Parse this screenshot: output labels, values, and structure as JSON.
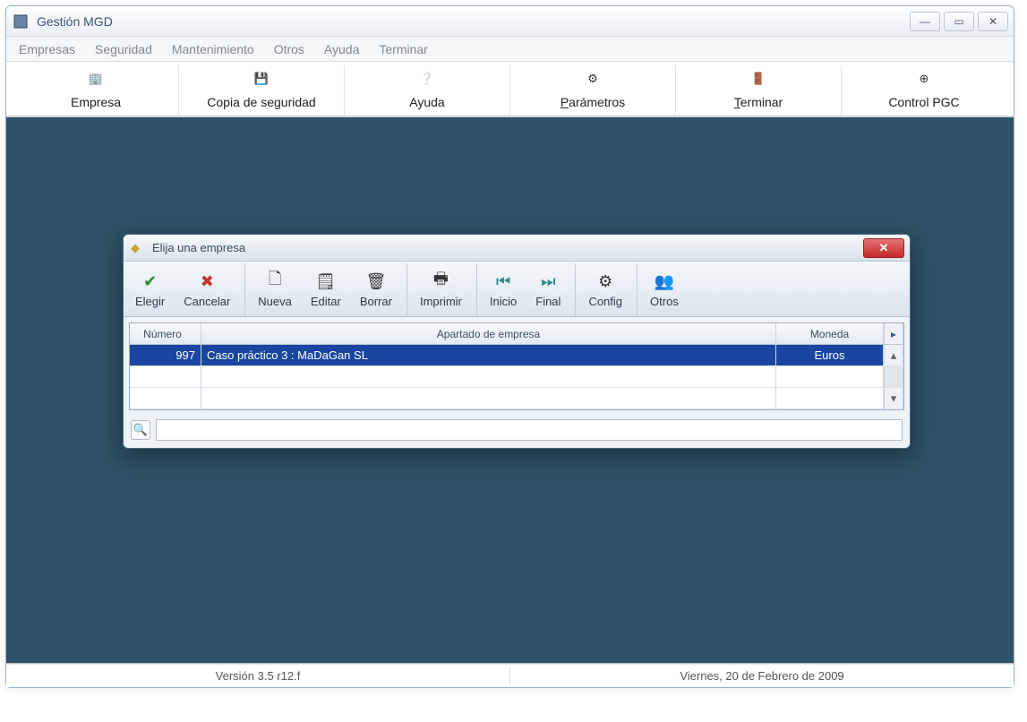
{
  "window": {
    "title": "Gestión MGD"
  },
  "menu": {
    "empresas": "Empresas",
    "seguridad": "Seguridad",
    "mantenimiento": "Mantenimiento",
    "otros": "Otros",
    "ayuda": "Ayuda",
    "terminar": "Terminar"
  },
  "toolbar": {
    "empresa": "Empresa",
    "copia": "Copia de seguridad",
    "ayuda": "Ayuda",
    "parametros": "Parámetros",
    "terminar": "Terminar",
    "controlpgc": "Control PGC"
  },
  "dialog": {
    "title": "Elija una empresa",
    "buttons": {
      "elegir": "Elegir",
      "cancelar": "Cancelar",
      "nueva": "Nueva",
      "editar": "Editar",
      "borrar": "Borrar",
      "imprimir": "Imprimir",
      "inicio": "Inicio",
      "final": "Final",
      "config": "Config",
      "otros": "Otros"
    },
    "columns": {
      "numero": "Número",
      "apartado": "Apartado de empresa",
      "moneda": "Moneda"
    },
    "rows": [
      {
        "numero": "997",
        "nombre": "Caso práctico 3 : MaDaGan SL",
        "moneda": "Euros"
      }
    ],
    "search_value": ""
  },
  "status": {
    "version": "Versión 3.5 r12.f",
    "date": "Viernes, 20 de Febrero de 2009"
  },
  "icons": {
    "check": "✔",
    "x": "✖",
    "new": "🗋",
    "edit": "🗒",
    "delete": "🗑",
    "print": "🖶",
    "first": "⏮",
    "last": "⏭",
    "gear": "⚙",
    "people": "👥",
    "search": "🔍",
    "help": "❔",
    "diamond": "◆"
  }
}
